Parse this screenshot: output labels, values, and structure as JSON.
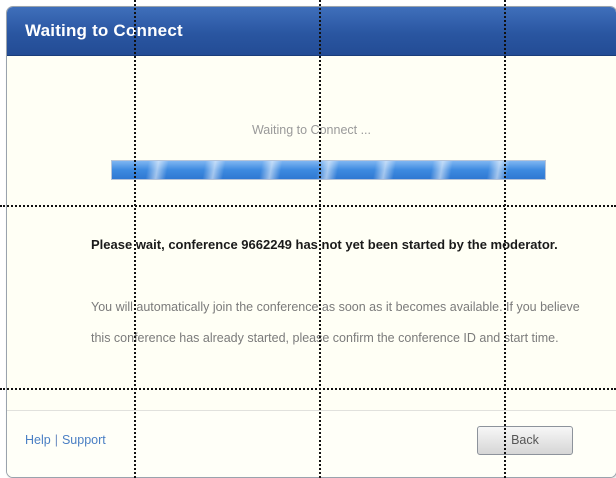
{
  "dialog": {
    "title": "Waiting to Connect",
    "status_text": "Waiting to Connect ...",
    "progress_state": "indeterminate",
    "message_title": "Please wait, conference 9662249 has not yet been started by the moderator.",
    "message_body": "You will automatically join the conference as soon as it becomes available. If you believe this conference has already started, please confirm the conference ID and start time."
  },
  "footer": {
    "help_label": "Help",
    "separator": "|",
    "support_label": "Support",
    "back_label": "Back"
  },
  "colors": {
    "title_bar": "#2a56a1",
    "background": "#fffff5",
    "progress": "#3d8ae0",
    "link": "#4a7fc4"
  }
}
